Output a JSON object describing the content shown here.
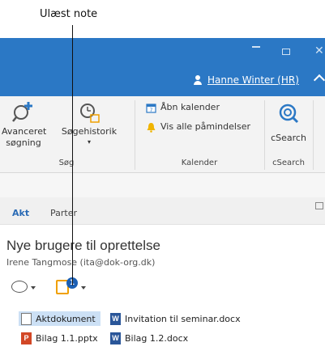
{
  "callout": {
    "label": "Ulæst note"
  },
  "titlebar": {
    "user_name": "Hanne Winter (HR)"
  },
  "ribbon": {
    "groups": [
      {
        "label": "Søg"
      },
      {
        "label": "Kalender"
      },
      {
        "label": "cSearch"
      }
    ],
    "avanceret": {
      "line1": "Avanceret",
      "line2": "søgning"
    },
    "soegehistorik": {
      "label": "Søgehistorik"
    },
    "aabn_kalender": {
      "label": "Åbn kalender"
    },
    "vis_paamindelser": {
      "label": "Vis alle påmindelser"
    },
    "csearch": {
      "label": "cSearch"
    }
  },
  "tabs": {
    "akt": "Akt",
    "parter": "Parter"
  },
  "message": {
    "subject": "Nye brugere til oprettelse",
    "sender": "Irene Tangmose (ita@dok-org.dk)"
  },
  "toolbar": {
    "note_badge": "1"
  },
  "attachments": [
    {
      "label": "Aktdokument",
      "icon": "blank-document-icon",
      "selected": true
    },
    {
      "label": "Invitation til seminar.docx",
      "icon": "word-document-icon",
      "selected": false
    },
    {
      "label": "Bilag 1.1.pptx",
      "icon": "powerpoint-icon",
      "selected": false
    },
    {
      "label": "Bilag 1.2.docx",
      "icon": "word-document-icon",
      "selected": false
    }
  ],
  "colors": {
    "titlebar": "#2b78c5",
    "ribbon_background": "#f3f3f3",
    "tab_active": "#2b6bb5",
    "selection": "#cce0f5",
    "note_badge": "#1b5fb4",
    "note_icon": "#f0a000"
  }
}
